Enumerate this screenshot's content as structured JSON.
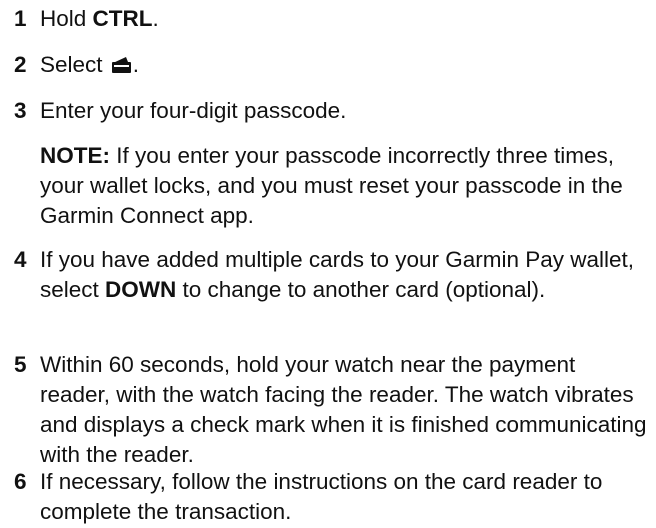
{
  "steps": [
    {
      "num": "1",
      "pre": "Hold ",
      "bold": "CTRL",
      "post": "."
    },
    {
      "num": "2",
      "pre": "Select ",
      "icon": "wallet-icon",
      "post": "."
    },
    {
      "num": "3",
      "text": "Enter your four-digit passcode."
    },
    {
      "note_label": "NOTE:",
      "note_text": " If you enter your passcode incorrectly three times, your wallet locks, and you must reset your passcode in the Garmin Connect app."
    },
    {
      "num": "4",
      "pre": "If you have added multiple cards to your Garmin Pay wallet, select ",
      "bold": "DOWN",
      "post": " to change to another card (optional)."
    },
    {
      "num": "5",
      "text": "Within 60 seconds, hold your watch near the payment reader, with the watch facing the reader. The watch vibrates and displays a check mark when it is finished communicating with the reader."
    },
    {
      "num": "6",
      "text": "If necessary, follow the instructions on the card reader to complete the transaction."
    }
  ]
}
